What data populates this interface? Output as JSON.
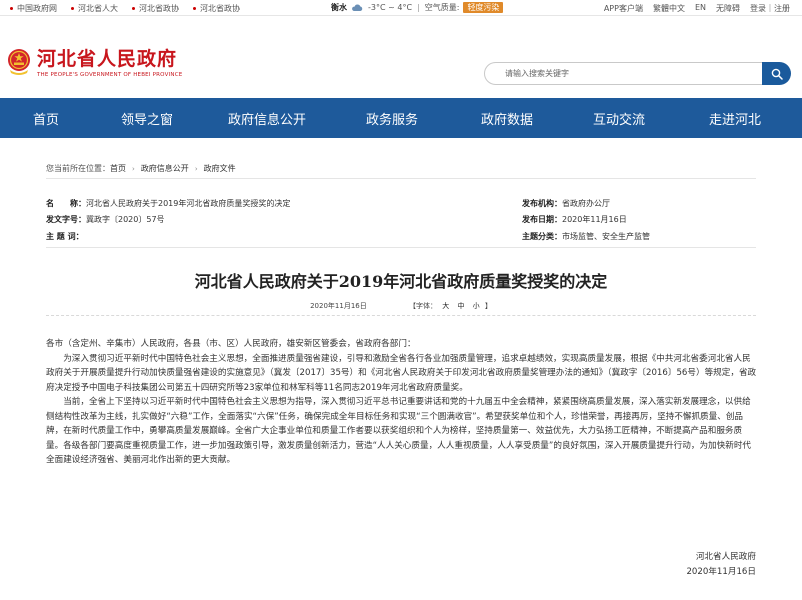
{
  "topbar": {
    "links": [
      "中国政府网",
      "河北省人大",
      "河北省政协",
      "河北省政协"
    ],
    "weather": {
      "city": "衡水",
      "icon": "cloud-icon",
      "temp": "-3°C ~ 4°C",
      "aqi_label": "空气质量:",
      "aqi_value": "轻度污染",
      "aqi_color": "#e08a2a"
    },
    "tools": [
      "APP客户端",
      "繁體中文",
      "EN",
      "无障碍",
      "登录｜注册"
    ]
  },
  "logo": {
    "title": "河北省人民政府",
    "subtitle": "THE PEOPLE'S GOVERNMENT OF HEBEI PROVINCE",
    "brand_color": "#c8161d"
  },
  "search": {
    "placeholder": "请输入搜索关键字",
    "button_icon": "search-icon"
  },
  "nav": {
    "bg_color": "#1e5a9b",
    "items": [
      "首页",
      "领导之窗",
      "政府信息公开",
      "政务服务",
      "政府数据",
      "互动交流",
      "走进河北"
    ]
  },
  "breadcrumb": {
    "prefix": "您当前所在位置：",
    "items": [
      "首页",
      "政府信息公开",
      "政府文件"
    ]
  },
  "meta": {
    "name_label": "名　　称：",
    "name_value": "河北省人民政府关于2019年河北省政府质量奖授奖的决定",
    "doc_no_label": "发文字号：",
    "doc_no_value": "冀政字〔2020〕57号",
    "topic_label": "主 题 词：",
    "topic_value": "",
    "issuer_label": "发布机构：",
    "issuer_value": "省政府办公厅",
    "date_label": "发布日期：",
    "date_value": "2020年11月16日",
    "category_label": "主题分类：",
    "category_value": "市场监管、安全生产监管"
  },
  "doc": {
    "title": "河北省人民政府关于2019年河北省政府质量奖授奖的决定",
    "date": "2020年11月16日",
    "font_label": "【字体：",
    "font_sizes": [
      "大",
      "中",
      "小"
    ],
    "font_close": "】",
    "salutation": "各市（含定州、辛集市）人民政府，各县（市、区）人民政府，雄安新区管委会，省政府各部门：",
    "para1": "为深入贯彻习近平新时代中国特色社会主义思想，全面推进质量强省建设，引导和激励全省各行各业加强质量管理，追求卓越绩效，实现高质量发展，根据《中共河北省委河北省人民政府关于开展质量提升行动加快质量强省建设的实施意见》（冀发〔2017〕35号）和《河北省人民政府关于印发河北省政府质量奖管理办法的通知》（冀政字〔2016〕56号）等规定，省政府决定授予中国电子科技集团公司第五十四研究所等23家单位和林军科等11名同志2019年河北省政府质量奖。",
    "para2": "当前，全省上下坚持以习近平新时代中国特色社会主义思想为指导，深入贯彻习近平总书记重要讲话和党的十九届五中全会精神，紧紧围绕高质量发展，深入落实新发展理念，以供给侧结构性改革为主线，扎实做好“六稳”工作，全面落实“六保”任务，确保完成全年目标任务和实现“三个圆满收官”。希望获奖单位和个人，珍惜荣誉，再接再厉，坚持不懈抓质量、创品牌，在新时代质量工作中，勇攀高质量发展巅峰。全省广大企事业单位和质量工作者要以获奖组织和个人为榜样，坚持质量第一、效益优先，大力弘扬工匠精神，不断提高产品和服务质量。各级各部门要高度重视质量工作，进一步加强政策引导，激发质量创新活力，营造“人人关心质量，人人重视质量，人人享受质量”的良好氛围，深入开展质量提升行动，为加快新时代全面建设经济强省、美丽河北作出新的更大贡献。",
    "signature": "河北省人民政府",
    "sign_date": "2020年11月16日"
  }
}
